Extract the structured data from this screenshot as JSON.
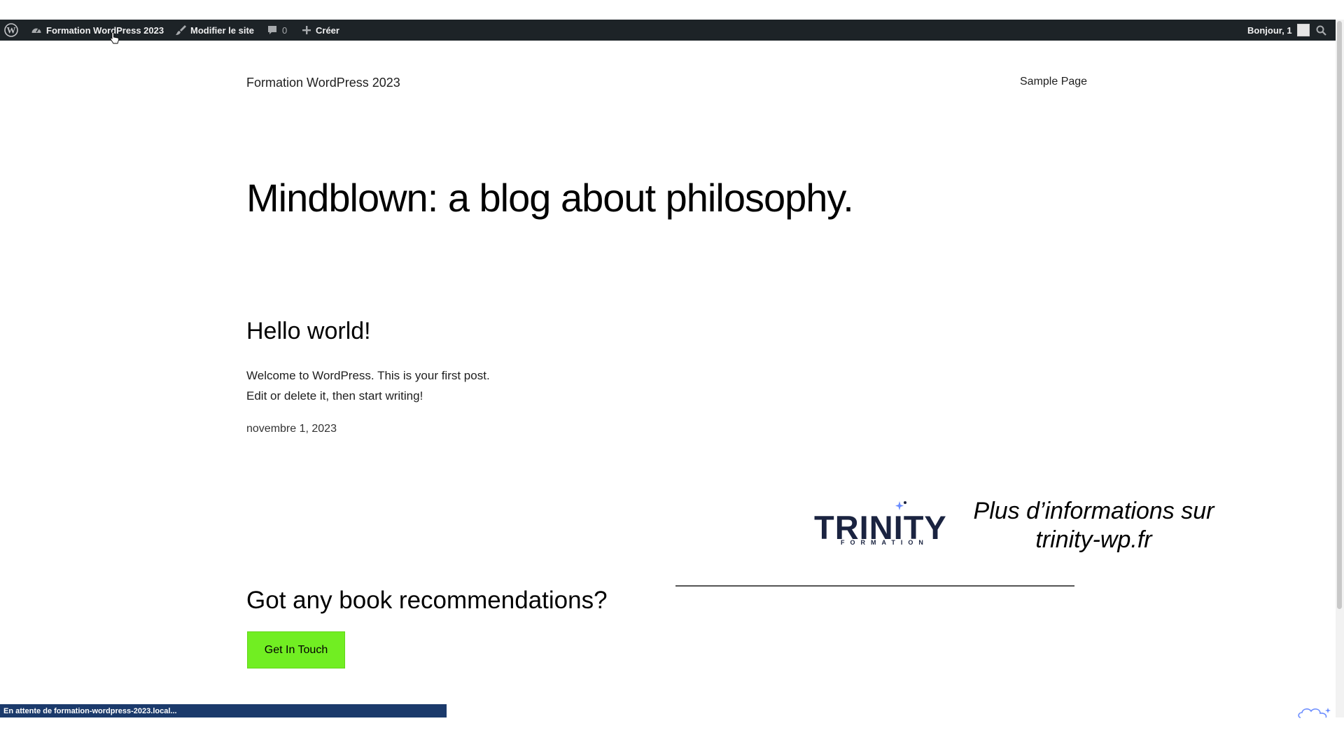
{
  "adminbar": {
    "site_name": "Formation WordPress 2023",
    "edit_site": "Modifier le site",
    "comments_count": "0",
    "new_label": "Créer",
    "greeting": "Bonjour, 1"
  },
  "site": {
    "title": "Formation WordPress 2023",
    "nav_items": [
      "Sample Page"
    ],
    "hero": "Mindblown: a blog about philosophy."
  },
  "post": {
    "title": "Hello world!",
    "excerpt_line1": "Welcome to WordPress. This is your first post.",
    "excerpt_line2": "Edit or delete it, then start writing!",
    "date": "novembre 1, 2023"
  },
  "cta_section": {
    "heading": "Got any book recommendations?",
    "button_label": "Get In Touch"
  },
  "promo": {
    "logo_word": "TRINITY",
    "logo_sub": "FORMATION",
    "line1": "Plus d’informations sur",
    "line2": "trinity-wp.fr"
  },
  "status": "En attente de formation-wordpress-2023.local...",
  "colors": {
    "adminbar_bg": "#1d2327",
    "cta_bg": "#71ee22",
    "statusbar_bg": "#1b3a6b",
    "brand_navy": "#1a2340"
  }
}
